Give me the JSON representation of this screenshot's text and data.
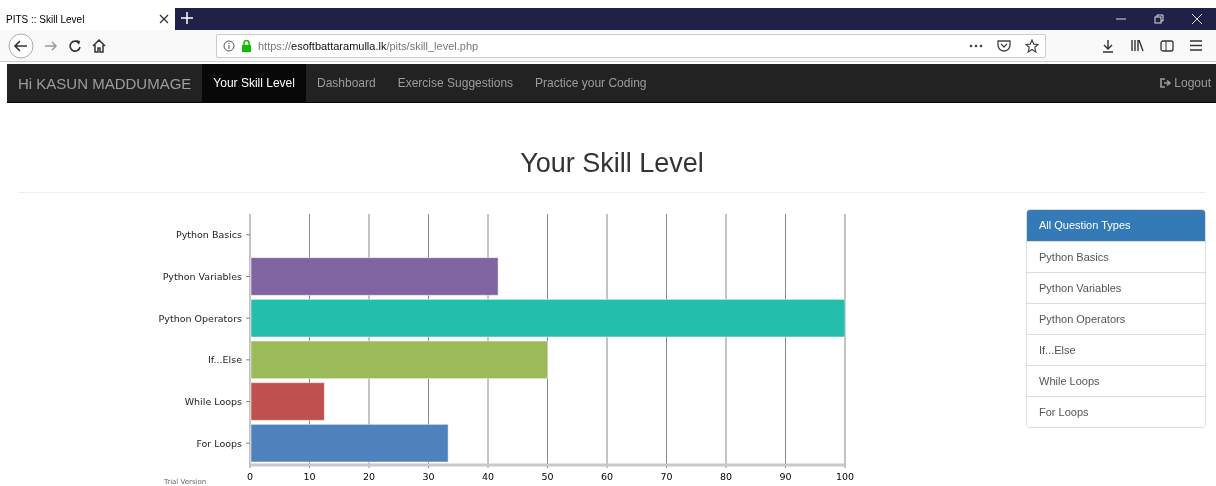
{
  "browser": {
    "tab_title": "PITS :: Skill Level",
    "url": {
      "scheme": "https://",
      "host": "esoftbattaramulla.lk",
      "path": "/pits/skill_level.php"
    }
  },
  "navbar": {
    "brand": "Hi KASUN MADDUMAGE",
    "items": [
      {
        "label": "Your Skill Level",
        "selected": true
      },
      {
        "label": "Dashboard",
        "selected": false
      },
      {
        "label": "Exercise Suggestions",
        "selected": false
      },
      {
        "label": "Practice your Coding",
        "selected": false
      }
    ],
    "logout": "Logout"
  },
  "heading": "Your Skill Level",
  "chart": {
    "footnote": "Trial Version",
    "chart_data": {
      "type": "bar",
      "orientation": "horizontal",
      "categories": [
        "Python Basics",
        "Python Variables",
        "Python Operators",
        "If...Else",
        "While Loops",
        "For Loops"
      ],
      "values": [
        0,
        41.7,
        100,
        50,
        12.5,
        33.3
      ],
      "colors": [
        null,
        "#8064a2",
        "#23bfaa",
        "#9bbb59",
        "#c0504d",
        "#4f81bd"
      ],
      "grid": true,
      "xlim": [
        0,
        100
      ],
      "xticks": [
        0,
        10,
        20,
        30,
        40,
        50,
        60,
        70,
        80,
        90,
        100
      ]
    }
  },
  "question_types": [
    {
      "label": "All Question Types",
      "selected": true
    },
    {
      "label": "Python Basics",
      "selected": false
    },
    {
      "label": "Python Variables",
      "selected": false
    },
    {
      "label": "Python Operators",
      "selected": false
    },
    {
      "label": "If...Else",
      "selected": false
    },
    {
      "label": "While Loops",
      "selected": false
    },
    {
      "label": "For Loops",
      "selected": false
    }
  ]
}
